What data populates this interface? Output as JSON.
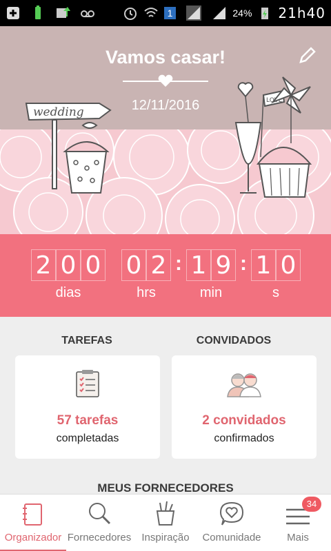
{
  "status_bar": {
    "battery_percent": "24%",
    "time": "21h40",
    "notification_count": "1"
  },
  "header": {
    "title": "Vamos casar!",
    "date": "12/11/2016",
    "sign_text": "wedding",
    "flag_text": "LOVE"
  },
  "countdown": {
    "days": [
      "2",
      "0",
      "0"
    ],
    "hours": [
      "0",
      "2"
    ],
    "minutes": [
      "1",
      "9"
    ],
    "seconds": [
      "1",
      "0"
    ],
    "separator": ":",
    "labels": {
      "days": "dias",
      "hours": "hrs",
      "minutes": "min",
      "seconds": "s"
    }
  },
  "tasks": {
    "heading": "TAREFAS",
    "count": "57 tarefas",
    "sub": "completadas"
  },
  "guests": {
    "heading": "CONVIDADOS",
    "count": "2 convidados",
    "sub": "confirmados"
  },
  "vendors": {
    "heading": "MEUS FORNECEDORES"
  },
  "nav": {
    "items": [
      {
        "label": "Organizador",
        "icon": "notebook-icon"
      },
      {
        "label": "Fornecedores",
        "icon": "search-icon"
      },
      {
        "label": "Inspiração",
        "icon": "brush-cup-icon"
      },
      {
        "label": "Comunidade",
        "icon": "heart-chat-icon"
      },
      {
        "label": "Mais",
        "icon": "menu-icon"
      }
    ],
    "more_badge": "34"
  },
  "colors": {
    "accent": "#f2717f",
    "hero_bg": "#c9b4b3",
    "text_accent": "#e0656f"
  }
}
